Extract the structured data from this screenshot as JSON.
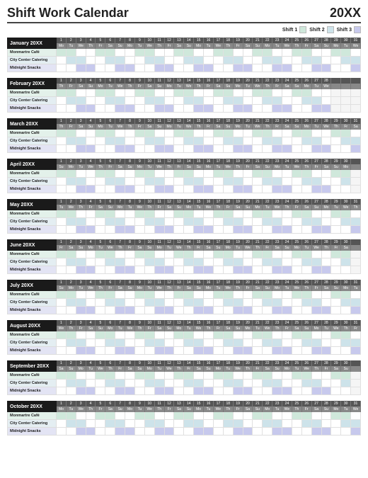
{
  "title": "Shift Work Calendar",
  "year": "20XX",
  "legend": {
    "shift1": "Shift 1",
    "shift2": "Shift 2",
    "shift3": "Shift 3"
  },
  "colors": {
    "shift1": "#cfe8db",
    "shift2": "#cde3ea",
    "shift3": "#c7c9ed"
  },
  "dows": [
    "Mo",
    "Tu",
    "We",
    "Th",
    "Fr",
    "Sa",
    "Su"
  ],
  "rowNames": [
    "Monmartre Café",
    "City Center Catering",
    "Midnight Snacks"
  ],
  "months": [
    {
      "name": "January 20XX",
      "startDow": 0,
      "days": 31
    },
    {
      "name": "February 20XX",
      "startDow": 3,
      "days": 28
    },
    {
      "name": "March 20XX",
      "startDow": 3,
      "days": 31
    },
    {
      "name": "April 20XX",
      "startDow": 6,
      "days": 30
    },
    {
      "name": "May 20XX",
      "startDow": 1,
      "days": 31
    },
    {
      "name": "June 20XX",
      "startDow": 4,
      "days": 30
    },
    {
      "name": "July 20XX",
      "startDow": 6,
      "days": 31
    },
    {
      "name": "August 20XX",
      "startDow": 2,
      "days": 31
    },
    {
      "name": "September 20XX",
      "startDow": 5,
      "days": 30
    },
    {
      "name": "October 20XX",
      "startDow": 0,
      "days": 31
    }
  ],
  "shiftPattern": {
    "shift1": [
      1,
      1,
      0,
      0,
      1,
      1,
      0,
      0,
      1,
      1,
      0,
      0,
      1,
      1,
      0,
      0,
      1,
      1,
      0,
      0,
      1,
      1,
      0,
      0,
      1,
      1,
      0,
      0,
      1,
      1,
      0
    ],
    "shift2": [
      0,
      1,
      1,
      0,
      0,
      1,
      1,
      0,
      0,
      1,
      1,
      0,
      0,
      1,
      1,
      0,
      0,
      1,
      1,
      0,
      0,
      1,
      1,
      0,
      0,
      1,
      1,
      0,
      0,
      1,
      1
    ],
    "shift3": [
      0,
      0,
      1,
      1,
      0,
      0,
      1,
      1,
      0,
      0,
      1,
      1,
      0,
      0,
      1,
      1,
      0,
      0,
      1,
      1,
      0,
      0,
      1,
      1,
      0,
      0,
      1,
      1,
      0,
      0,
      1
    ]
  }
}
